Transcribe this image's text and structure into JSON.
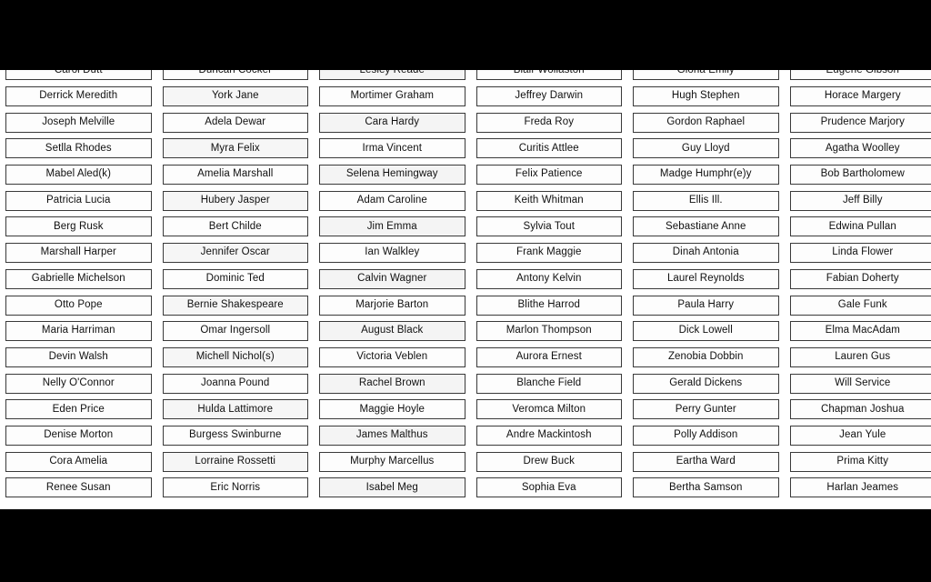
{
  "page": {
    "background_color": "#000000",
    "content_background_color": "#ffffff",
    "cell_border_color": "#3a3a3a",
    "text_color": "#101010",
    "columns": 6,
    "rows": 18
  },
  "grid": {
    "columns": [
      {
        "index": 0,
        "cells": [
          "Carol Dutt",
          "Derrick Meredith",
          "Joseph Melville",
          "Setlla Rhodes",
          "Mabel Aled(k)",
          "Patricia Lucia",
          "Berg Rusk",
          "Marshall Harper",
          "Gabrielle Michelson",
          "Otto Pope",
          "Maria Harriman",
          "Devin Walsh",
          "Nelly O'Connor",
          "Eden Price",
          "Denise Morton",
          "Cora Amelia",
          "Renee Susan"
        ]
      },
      {
        "index": 1,
        "cells": [
          "Duncan Cocker",
          "York Jane",
          "Adela Dewar",
          "Myra Felix",
          "Amelia Marshall",
          "Hubery Jasper",
          "Bert Childe",
          "Jennifer Oscar",
          "Dominic Ted",
          "Bernie Shakespeare",
          "Omar Ingersoll",
          "Michell Nichol(s)",
          "Joanna Pound",
          "Hulda Lattimore",
          "Burgess Swinburne",
          "Lorraine Rossetti",
          "Eric Norris"
        ]
      },
      {
        "index": 2,
        "cells": [
          "Lesley Reade",
          "Mortimer Graham",
          "Cara Hardy",
          "Irma Vincent",
          "Selena Hemingway",
          "Adam Caroline",
          "Jim Emma",
          "Ian Walkley",
          "Calvin Wagner",
          "Marjorie Barton",
          "August Black",
          "Victoria Veblen",
          "Rachel Brown",
          "Maggie Hoyle",
          "James Malthus",
          "Murphy Marcellus",
          "Isabel Meg"
        ]
      },
      {
        "index": 3,
        "cells": [
          "Blair Wollaston",
          "Jeffrey Darwin",
          "Freda Roy",
          "Curitis Attlee",
          "Felix Patience",
          "Keith Whitman",
          "Sylvia Tout",
          "Frank Maggie",
          "Antony Kelvin",
          "Blithe Harrod",
          "Marlon Thompson",
          "Aurora Ernest",
          "Blanche Field",
          "Veromca Milton",
          "Andre Mackintosh",
          "Drew Buck",
          "Sophia Eva"
        ]
      },
      {
        "index": 4,
        "cells": [
          "Gloria Emily",
          "Hugh Stephen",
          "Gordon Raphael",
          "Guy Lloyd",
          "Madge Humphr(e)y",
          "Ellis Ill.",
          "Sebastiane Anne",
          "Dinah Antonia",
          "Laurel Reynolds",
          "Paula Harry",
          "Dick Lowell",
          "Zenobia Dobbin",
          "Gerald Dickens",
          "Perry Gunter",
          "Polly Addison",
          "Eartha Ward",
          "Bertha Samson"
        ]
      },
      {
        "index": 5,
        "cells": [
          "Eugene Gibson",
          "Horace Margery",
          "Prudence Marjory",
          "Agatha Woolley",
          "Bob Bartholomew",
          "Jeff Billy",
          "Edwina Pullan",
          "Linda Flower",
          "Fabian Doherty",
          "Gale Funk",
          "Elma MacAdam",
          "Lauren Gus",
          "Will Service",
          "Chapman Joshua",
          "Jean Yule",
          "Prima Kitty",
          "Harlan Jeames"
        ]
      }
    ]
  }
}
